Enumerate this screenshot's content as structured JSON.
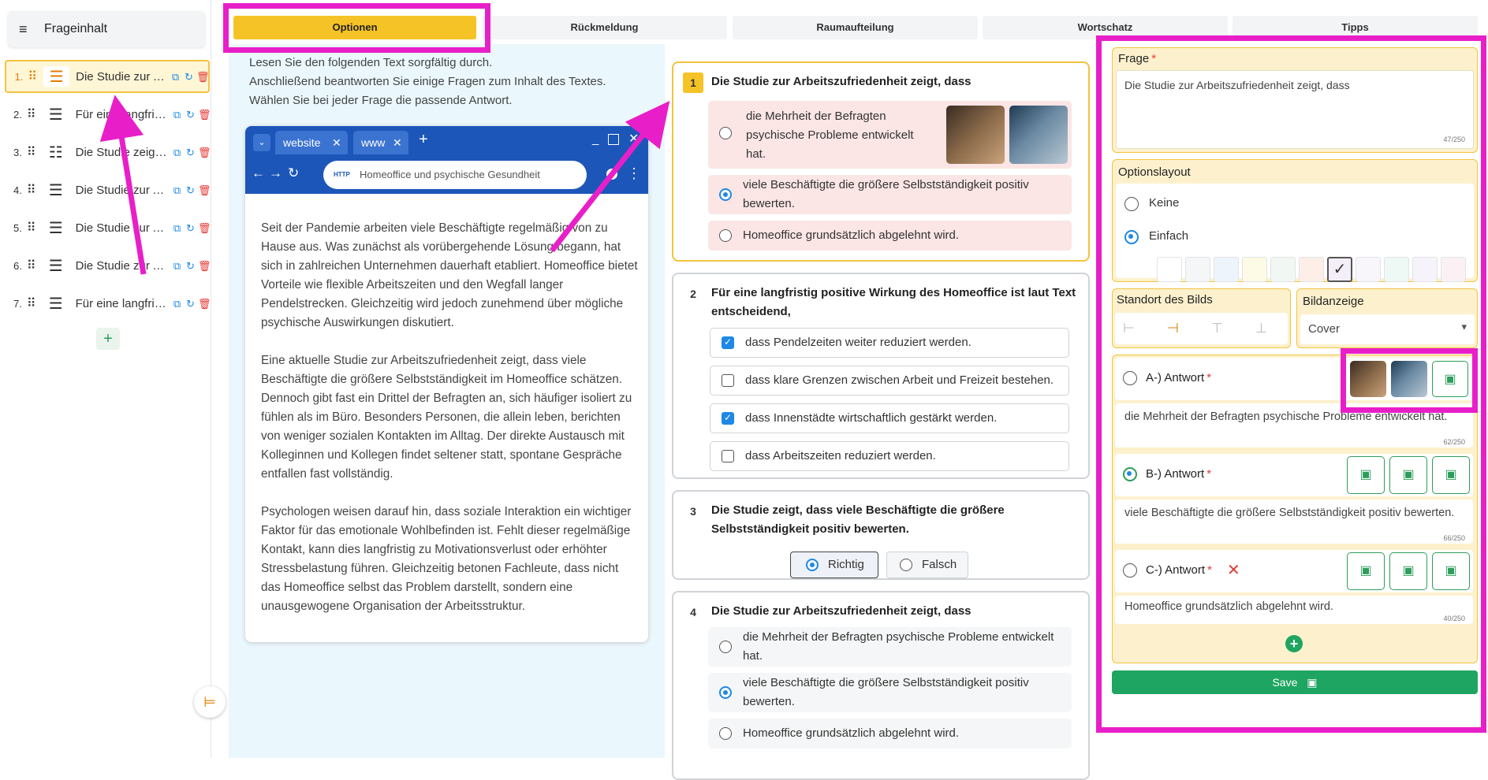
{
  "sidebar": {
    "title": "Frageinhalt",
    "items": [
      {
        "num": "1.",
        "label": "Die Studie zur Arbeitszufriedenheit zeigt, dass"
      },
      {
        "num": "2.",
        "label": "Für eine langfristig positive Wirkung"
      },
      {
        "num": "3.",
        "label": "Die Studie zeigt, dass viele"
      },
      {
        "num": "4.",
        "label": "Die Studie zur Arbeitszufriedenheit"
      },
      {
        "num": "5.",
        "label": "Die Studie zur Arbeitszufriedenheit"
      },
      {
        "num": "6.",
        "label": "Die Studie zur Arbeitszufriedenheit"
      },
      {
        "num": "7.",
        "label": "Für eine langfristig positive Wirkung"
      }
    ],
    "add_label": "+"
  },
  "tabs": [
    "Optionen",
    "Rückmeldung",
    "Raumaufteilung",
    "Wortschatz",
    "Tipps"
  ],
  "text": {
    "intro": [
      "Lesen Sie den folgenden Text sorgfältig durch.",
      "Anschließend beantworten Sie einige Fragen zum Inhalt des Textes.",
      "Wählen Sie bei jeder Frage die passende Antwort."
    ],
    "browser": {
      "tab1": "website",
      "tab2": "www",
      "url": "Homeoffice und psychische Gesundheit",
      "url_badge": "HTTP"
    },
    "paragraphs": [
      "Seit der Pandemie arbeiten viele Beschäftigte regelmäßig von zu Hause aus. Was zunächst als vorübergehende Lösung begann, hat sich in zahlreichen Unternehmen dauerhaft etabliert. Homeoffice bietet Vorteile wie flexible Arbeitszeiten und den Wegfall langer Pendelstrecken. Gleichzeitig wird jedoch zunehmend über mögliche psychische Auswirkungen diskutiert.",
      "Eine aktuelle Studie zur Arbeitszufriedenheit zeigt, dass viele Beschäftigte die größere Selbstständigkeit im Homeoffice schätzen. Dennoch gibt fast ein Drittel der Befragten an, sich häufiger isoliert zu fühlen als im Büro. Besonders Personen, die allein leben, berichten von weniger sozialen Kontakten im Alltag. Der direkte Austausch mit Kolleginnen und Kollegen findet seltener statt, spontane Gespräche entfallen fast vollständig.",
      "Psychologen weisen darauf hin, dass soziale Interaktion ein wichtiger Faktor für das emotionale Wohlbefinden ist. Fehlt dieser regelmäßige Kontakt, kann dies langfristig zu Motivationsverlust oder erhöhter Stressbelastung führen. Gleichzeitig betonen Fachleute, dass nicht das Homeoffice selbst das Problem darstellt, sondern eine unausgewogene Organisation der Arbeitsstruktur."
    ]
  },
  "questions": [
    {
      "num": "1",
      "title": "Die Studie zur Arbeitszufriedenheit zeigt, dass",
      "options": [
        "die Mehrheit der Befragten psychische Probleme entwickelt hat.",
        "viele Beschäftigte die größere Selbstständigkeit positiv bewerten.",
        "Homeoffice grundsätzlich abgelehnt wird."
      ]
    },
    {
      "num": "2",
      "title": "Für eine langfristig positive Wirkung des Homeoffice ist laut Text entscheidend,",
      "options": [
        "dass Pendelzeiten weiter reduziert werden.",
        "dass klare Grenzen zwischen Arbeit und Freizeit bestehen.",
        "dass Innenstädte wirtschaftlich gestärkt werden.",
        "dass Arbeitszeiten reduziert werden."
      ]
    },
    {
      "num": "3",
      "title": "Die Studie zeigt, dass viele Beschäftigte die größere Selbstständigkeit positiv bewerten.",
      "true_label": "Richtig",
      "false_label": "Falsch"
    },
    {
      "num": "4",
      "title": "Die Studie zur Arbeitszufriedenheit zeigt, dass",
      "options": [
        "die Mehrheit der Befragten psychische Probleme entwickelt hat.",
        "viele Beschäftigte die größere Selbstständigkeit positiv bewerten.",
        "Homeoffice grundsätzlich abgelehnt wird."
      ]
    }
  ],
  "editor": {
    "question_label": "Frage",
    "question_value": "Die Studie zur Arbeitszufriedenheit zeigt, dass",
    "question_counter": "47/250",
    "layout_label": "Optionslayout",
    "layout_none": "Keine",
    "layout_simple": "Einfach",
    "image_location_label": "Standort des Bilds",
    "image_display_label": "Bildanzeige",
    "image_display_value": "Cover",
    "answers": [
      {
        "label": "A-) Antwort",
        "value": "die Mehrheit der Befragten psychische Probleme entwickelt hat.",
        "counter": "62/250"
      },
      {
        "label": "B-) Antwort",
        "value": "viele Beschäftigte die größere Selbstständigkeit positiv bewerten.",
        "counter": "66/250"
      },
      {
        "label": "C-) Antwort",
        "value": "Homeoffice grundsätzlich abgelehnt wird.",
        "counter": "40/250"
      }
    ],
    "save_label": "Save"
  },
  "colors": {
    "accent": "#f6c327",
    "highlight": "#e81fc9",
    "primary": "#1e88e5",
    "success": "#1fa562"
  }
}
